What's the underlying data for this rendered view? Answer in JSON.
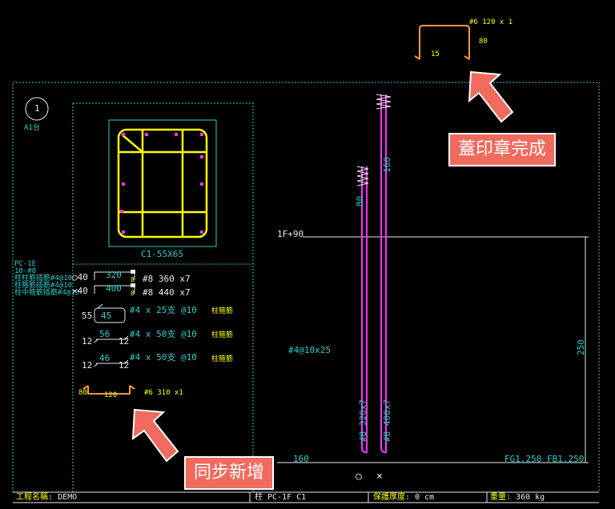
{
  "drawing": {
    "stirrup_top_label": "#6 120 x 1",
    "stirrup_top_dim_left": "15",
    "stirrup_top_dim_right": "80",
    "circle_marker": "1",
    "marker_caption": "A1台",
    "section_label": "C1-55X65",
    "level_label": "1F+90",
    "left_notes": [
      "PC-1E",
      "10-#8",
      "柱柱筋插筋#4@10",
      "柱箍筋插筋#4@10",
      "柱中箍筋插筋#4@15"
    ],
    "bar_rows": [
      {
        "prefix": "○40",
        "len": "320",
        "num": "8",
        "text": "#8 360 x7"
      },
      {
        "prefix": "×40",
        "len": "400",
        "num": "8",
        "text": "#8 440 x7"
      }
    ],
    "stirrups": [
      {
        "left": "55",
        "inner": "45",
        "text": "#4 x 25支 @10",
        "note": "柱箍筋"
      },
      {
        "left": "12",
        "inner": "56",
        "right": "12",
        "text": "#4 x 50支 @10",
        "note": "柱箍筋"
      },
      {
        "left": "12",
        "inner": "46",
        "right": "12",
        "text": "#4 x 50支 @10",
        "note": "柱箍筋"
      }
    ],
    "new_stirrup": {
      "left": "80",
      "inner": "120",
      "text": "#6 310 x1"
    },
    "hoop_spacing": "#4@10x25",
    "bar_left_dim": "80",
    "bar_right_dim": "160",
    "bar_left_label": "#8 320x7",
    "bar_right_label": "#8 400x7",
    "height_dim": "250",
    "bottom_dim": "160",
    "bottom_right_label": "FG1,250 FB1,250",
    "bottom_symbols": [
      "○",
      "×"
    ]
  },
  "footer": {
    "project_label": "工程名稱:",
    "project_value": "DEMO",
    "member": "柱 PC-1F C1",
    "cover_label": "保護厚度:",
    "cover_value": "0 cm",
    "weight_label": "重量:",
    "weight_value": "360 kg"
  },
  "callouts": {
    "stamp": "蓋印章完成",
    "sync": "同步新增"
  }
}
